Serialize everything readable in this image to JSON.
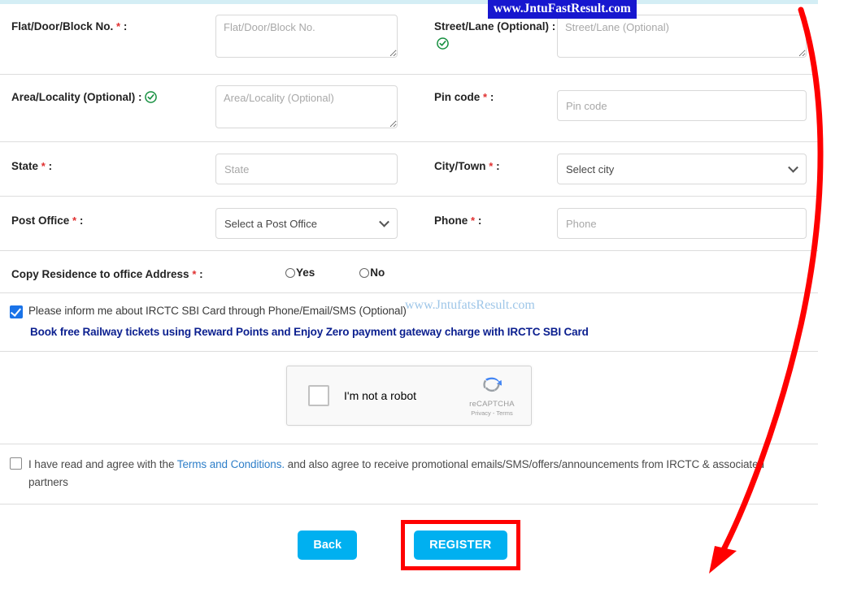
{
  "watermarks": {
    "badge": "www.JntuFastResult.com",
    "light": "www.JntufatsResult.com"
  },
  "colors": {
    "accent_button": "#00b0f0",
    "highlight_box": "#ff0000",
    "arrow": "#ff0000",
    "checkbox_checked": "#1a73e8",
    "verified_icon": "#158f3f",
    "required_star": "#e03030",
    "promo_link": "#0b1f8f",
    "terms_link": "#2f7fc9",
    "watermark_badge_bg": "#1717cf",
    "watermark_light_text": "#9ec6e8",
    "top_strip": "#d4eef5"
  },
  "form": {
    "rows": [
      {
        "left": {
          "label": "Flat/Door/Block No.",
          "required": true,
          "suffix": ":",
          "verified": false,
          "control": "textarea",
          "placeholder": "Flat/Door/Block No.",
          "value": ""
        },
        "right": {
          "label": "Street/Lane (Optional)",
          "required": false,
          "suffix": ":",
          "verified": true,
          "control": "textarea",
          "placeholder": "Street/Lane (Optional)",
          "value": ""
        }
      },
      {
        "left": {
          "label": "Area/Locality (Optional)",
          "required": false,
          "suffix": ":",
          "verified": true,
          "control": "textarea",
          "placeholder": "Area/Locality (Optional)",
          "value": ""
        },
        "right": {
          "label": "Pin code",
          "required": true,
          "suffix": ":",
          "verified": false,
          "control": "input",
          "placeholder": "Pin code",
          "value": ""
        }
      },
      {
        "left": {
          "label": "State",
          "required": true,
          "suffix": ":",
          "verified": false,
          "control": "input",
          "placeholder": "State",
          "value": ""
        },
        "right": {
          "label": "City/Town",
          "required": true,
          "suffix": ":",
          "verified": false,
          "control": "select",
          "selected": "Select city"
        }
      },
      {
        "left": {
          "label": "Post Office",
          "required": true,
          "suffix": ":",
          "verified": false,
          "control": "select",
          "selected": "Select a Post Office"
        },
        "right": {
          "label": "Phone",
          "required": true,
          "suffix": ":",
          "verified": false,
          "control": "input",
          "placeholder": "Phone",
          "value": ""
        }
      }
    ],
    "copy_address": {
      "label": "Copy Residence to office Address",
      "required": true,
      "suffix": ":",
      "options": [
        "Yes",
        "No"
      ],
      "selected": ""
    }
  },
  "promo": {
    "checkbox_checked": true,
    "text": "Please inform me about IRCTC SBI Card through Phone/Email/SMS (Optional)",
    "highlight": "Book free Railway tickets using Reward Points and Enjoy Zero payment gateway charge with IRCTC SBI Card"
  },
  "captcha": {
    "checkbox_checked": false,
    "label": "I'm not a robot",
    "brand": "reCAPTCHA",
    "links": "Privacy - Terms"
  },
  "terms": {
    "checkbox_checked": false,
    "before_link": "I have read and agree with the ",
    "link": "Terms and Conditions.",
    "after_link": " and also agree to receive promotional emails/SMS/offers/announcements from IRCTC & associated partners"
  },
  "buttons": {
    "back": "Back",
    "register": "REGISTER"
  }
}
